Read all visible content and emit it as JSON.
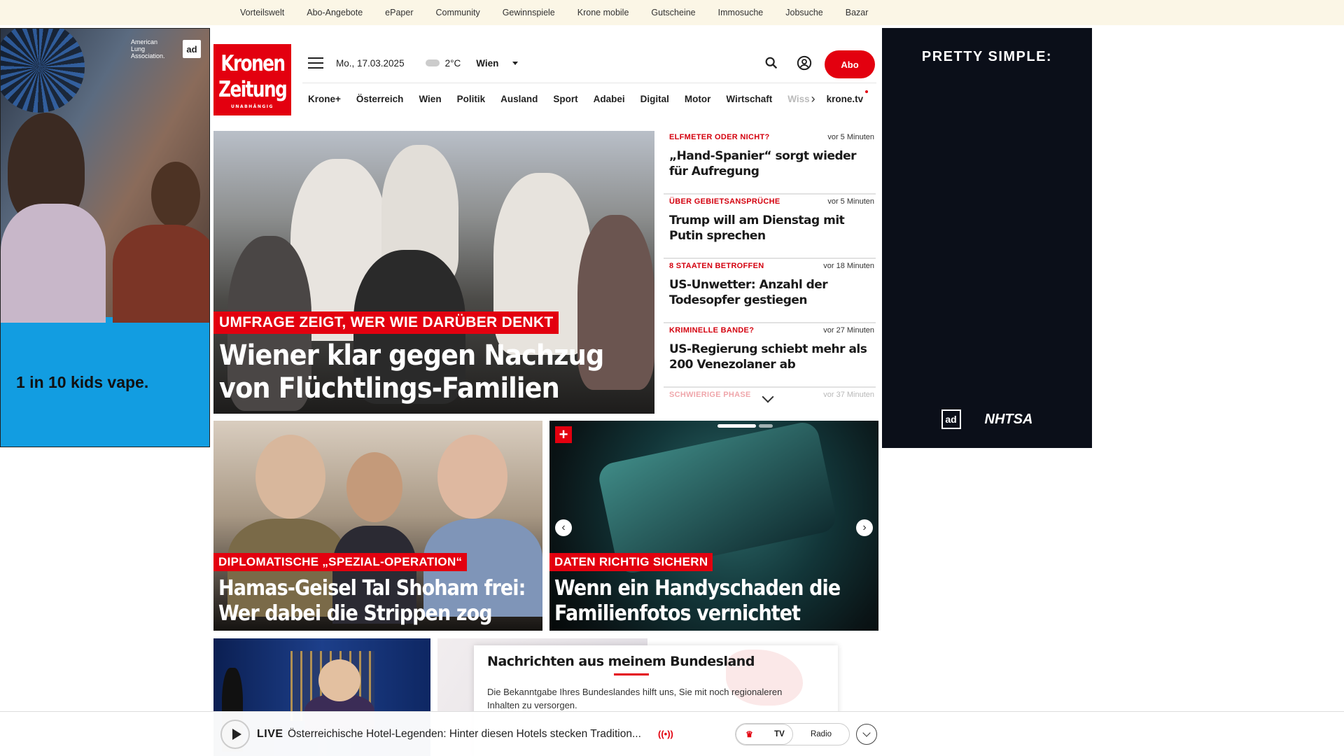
{
  "topbar": {
    "links": [
      "Vorteilswelt",
      "Abo-Angebote",
      "ePaper",
      "Community",
      "Gewinnspiele",
      "Krone mobile",
      "Gutscheine",
      "Immosuche",
      "Jobsuche",
      "Bazar"
    ]
  },
  "ad_left": {
    "logo_text": "American Lung Association.",
    "adcouncil_text": "ad",
    "tagline": "1 in 10 kids vape."
  },
  "ad_right": {
    "title": "PRETTY SIMPLE:",
    "adcouncil_text": "ad",
    "nhtsa_text": "NHTSA"
  },
  "logo": {
    "line1": "Kronen",
    "line2": "Zeitung",
    "line3": "UNABHÄNGIG"
  },
  "header": {
    "date": "Mo., 17.03.2025",
    "temperature": "2°C",
    "city": "Wien",
    "abo_label": "Abo"
  },
  "nav": {
    "items": [
      "Krone+",
      "Österreich",
      "Wien",
      "Politik",
      "Ausland",
      "Sport",
      "Adabei",
      "Digital",
      "Motor",
      "Wirtschaft"
    ],
    "truncated_item": "Wiss",
    "krone_tv": "krone.tv"
  },
  "hero": {
    "kicker": "UMFRAGE ZEIGT, WER WIE DARÜBER DENKT",
    "headline": "Wiener klar gegen Nachzug von Flüchtlings-Familien"
  },
  "ticker": [
    {
      "category": "ELFMETER ODER NICHT?",
      "time": "vor 5 Minuten",
      "title": "„Hand-Spanier“ sorgt wieder für Aufregung"
    },
    {
      "category": "ÜBER GEBIETSANSPRÜCHE",
      "time": "vor 5 Minuten",
      "title": "Trump will am Dienstag mit Putin sprechen"
    },
    {
      "category": "8 STAATEN BETROFFEN",
      "time": "vor 18 Minuten",
      "title": "US-Unwetter: Anzahl der Todesopfer gestiegen"
    },
    {
      "category": "KRIMINELLE BANDE?",
      "time": "vor 27 Minuten",
      "title": "US-Regierung schiebt mehr als 200 Venezolaner ab"
    },
    {
      "category": "SCHWIERIGE PHASE",
      "time": "vor 37 Minuten",
      "title": ""
    }
  ],
  "cards": [
    {
      "kicker": "DIPLOMATISCHE „SPEZIAL-OPERATION“",
      "headline": "Hamas-Geisel Tal Shoham frei: Wer dabei die Strippen zog"
    },
    {
      "kicker": "DATEN RICHTIG SICHERN",
      "headline": "Wenn ein Handyschaden die Familienfotos vernichtet",
      "badge": "+"
    }
  ],
  "bundesland": {
    "title": "Nachrichten aus meinem Bundesland",
    "text": "Die Bekanntgabe Ihres Bundeslandes hilft uns, Sie mit noch regionaleren Inhalten zu versorgen."
  },
  "live": {
    "label": "LIVE",
    "text": "Österreichische Hotel-Legenden: Hinter diesen Hotels stecken Tradition...",
    "radio_icon": "((•))",
    "tv_label": "TV",
    "radio_label": "Radio"
  },
  "colors": {
    "brand_red": "#e3000f",
    "topbar_bg": "#fbf6e6"
  }
}
